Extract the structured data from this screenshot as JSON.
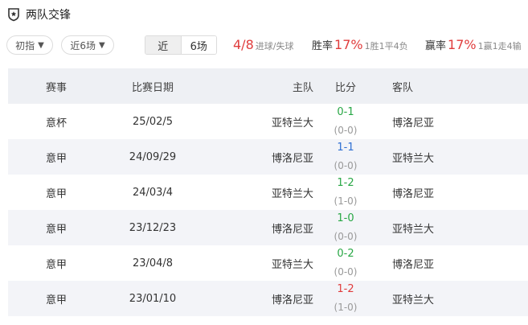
{
  "header": {
    "title": "两队交锋"
  },
  "filters": {
    "odds_label": "初指",
    "range_label": "近6场",
    "toggle": [
      "近",
      "6场"
    ]
  },
  "stats": {
    "goals": {
      "value": "4/8",
      "label": "进球/失球"
    },
    "win_rate": {
      "label": "胜率",
      "value": "17%",
      "detail": "1胜1平4负"
    },
    "handicap_rate": {
      "label": "赢率",
      "value": "17%",
      "detail": "1赢1走4输"
    }
  },
  "table": {
    "columns": [
      "赛事",
      "比赛日期",
      "主队",
      "比分",
      "客队"
    ],
    "rows": [
      {
        "competition": "意杯",
        "date": "25/02/5",
        "home": "亚特兰大",
        "ft": "0-1",
        "ht": "(0-0)",
        "away": "博洛尼亚",
        "result_color": "#28a745"
      },
      {
        "competition": "意甲",
        "date": "24/09/29",
        "home": "博洛尼亚",
        "ft": "1-1",
        "ht": "(0-0)",
        "away": "亚特兰大",
        "result_color": "#2f6fd3"
      },
      {
        "competition": "意甲",
        "date": "24/03/4",
        "home": "亚特兰大",
        "ft": "1-2",
        "ht": "(1-0)",
        "away": "博洛尼亚",
        "result_color": "#28a745"
      },
      {
        "competition": "意甲",
        "date": "23/12/23",
        "home": "博洛尼亚",
        "ft": "1-0",
        "ht": "(0-0)",
        "away": "亚特兰大",
        "result_color": "#28a745"
      },
      {
        "competition": "意甲",
        "date": "23/04/8",
        "home": "亚特兰大",
        "ft": "0-2",
        "ht": "(0-0)",
        "away": "博洛尼亚",
        "result_color": "#28a745"
      },
      {
        "competition": "意甲",
        "date": "23/01/10",
        "home": "博洛尼亚",
        "ft": "1-2",
        "ht": "(1-0)",
        "away": "亚特兰大",
        "result_color": "#e03c3c"
      }
    ]
  },
  "colors": {
    "accent_red": "#e03c3c",
    "green": "#28a745",
    "blue": "#2f6fd3",
    "header_bg": "#eef0f4",
    "alt_row_bg": "#f3f4f8"
  }
}
